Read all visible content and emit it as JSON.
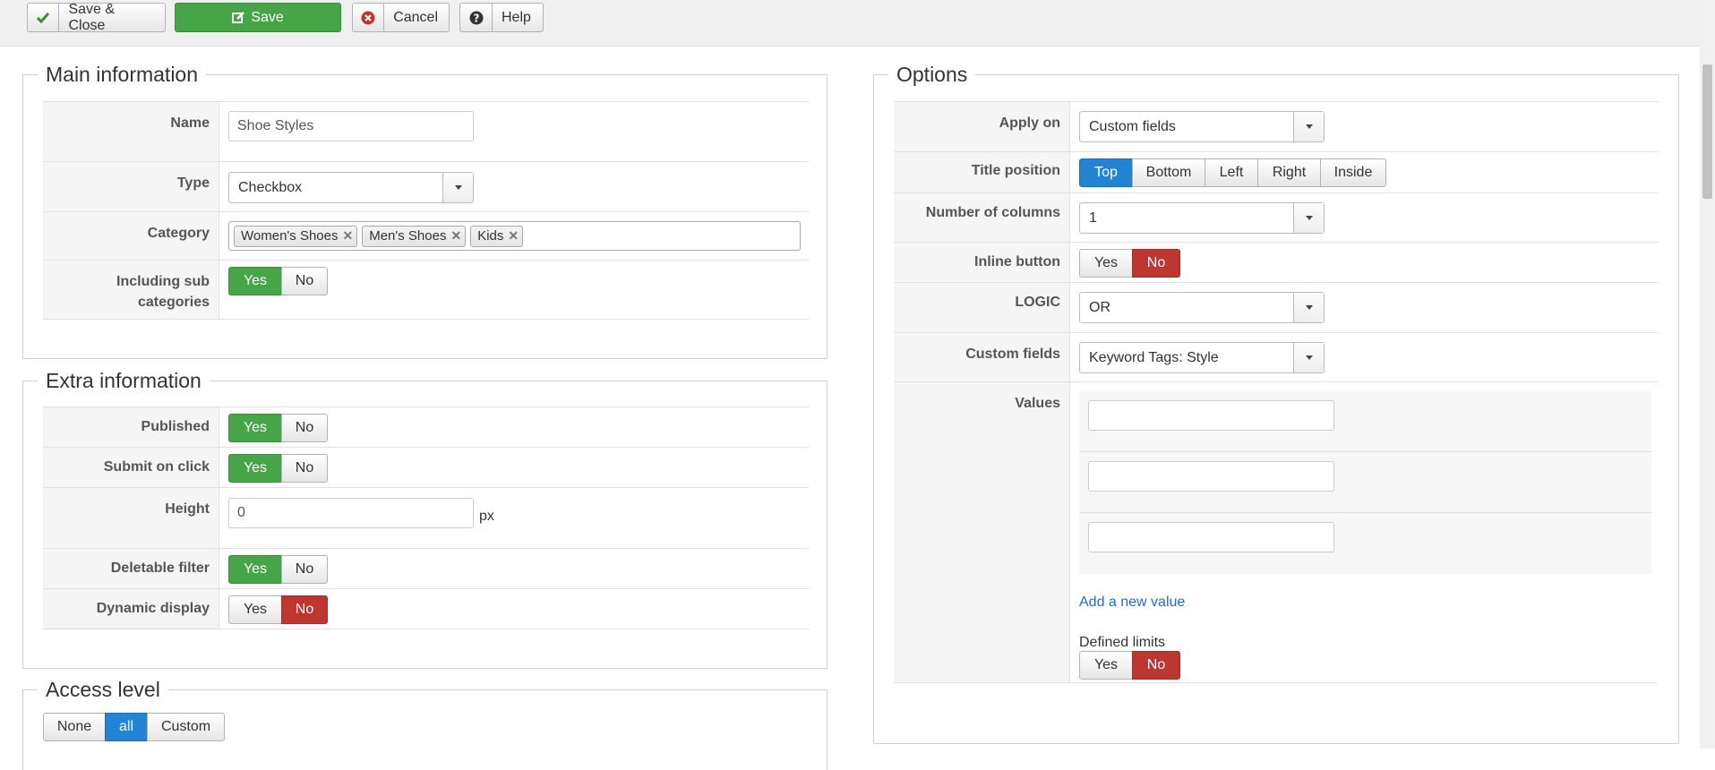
{
  "toolbar": {
    "save_close": "Save & Close",
    "save": "Save",
    "cancel": "Cancel",
    "help": "Help"
  },
  "main_info": {
    "legend": "Main information",
    "name_label": "Name",
    "name_value": "Shoe Styles",
    "type_label": "Type",
    "type_value": "Checkbox",
    "category_label": "Category",
    "categories": [
      "Women's Shoes",
      "Men's Shoes",
      "Kids"
    ],
    "sub_label_1": "Including sub",
    "sub_label_2": "categories",
    "sub_yes": "Yes",
    "sub_no": "No",
    "sub_selected": "Yes"
  },
  "extra_info": {
    "legend": "Extra information",
    "published_label": "Published",
    "published_yes": "Yes",
    "published_no": "No",
    "submit_label": "Submit on click",
    "submit_yes": "Yes",
    "submit_no": "No",
    "height_label": "Height",
    "height_value": "0",
    "height_unit": "px",
    "deletable_label": "Deletable filter",
    "deletable_yes": "Yes",
    "deletable_no": "No",
    "dynamic_label": "Dynamic display",
    "dynamic_yes": "Yes",
    "dynamic_no": "No"
  },
  "access": {
    "legend": "Access level",
    "none": "None",
    "all": "all",
    "custom": "Custom"
  },
  "options": {
    "legend": "Options",
    "apply_label": "Apply on",
    "apply_value": "Custom fields",
    "title_pos_label": "Title position",
    "title_pos": [
      "Top",
      "Bottom",
      "Left",
      "Right",
      "Inside"
    ],
    "columns_label": "Number of columns",
    "columns_value": "1",
    "inline_label": "Inline button",
    "inline_yes": "Yes",
    "inline_no": "No",
    "logic_label": "LOGIC",
    "logic_value": "OR",
    "custom_fields_label": "Custom fields",
    "custom_fields_value": "Keyword Tags: Style",
    "values_label": "Values",
    "values": [
      "",
      "",
      ""
    ],
    "add_value": "Add a new value",
    "limits_label": "Defined limits",
    "limits_yes": "Yes",
    "limits_no": "No"
  },
  "colors": {
    "green": "#46a546",
    "red": "#bd362f",
    "blue": "#2384d3",
    "link": "#2a69b8"
  }
}
